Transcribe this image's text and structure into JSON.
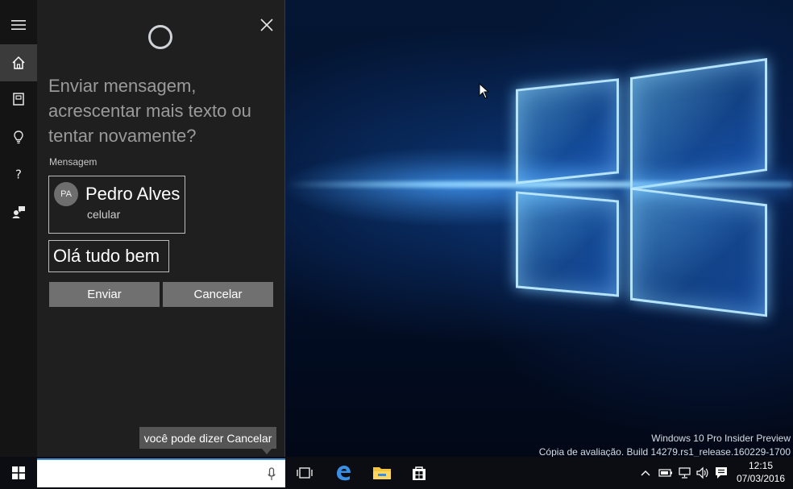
{
  "cortana": {
    "prompt": "Enviar mensagem, acrescentar mais texto ou tentar novamente?",
    "message_label": "Mensagem",
    "contact": {
      "initials": "PA",
      "name": "Pedro Alves",
      "type": "celular"
    },
    "message_text": "Olá tudo bem",
    "send_label": "Enviar",
    "cancel_label": "Cancelar",
    "tip": "você pode dizer Cancelar",
    "rail": [
      "menu-icon",
      "home-icon",
      "notebook-icon",
      "lightbulb-icon",
      "help-icon",
      "feedback-icon"
    ]
  },
  "desktop": {
    "watermark_line1": "Windows 10 Pro Insider Preview",
    "watermark_line2": "Cópia de avaliação. Build 14279.rs1_release.160229-1700"
  },
  "taskbar": {
    "pinned": [
      "task-view-icon",
      "edge-icon",
      "file-explorer-icon",
      "store-icon"
    ],
    "tray": [
      "chevron-up-icon",
      "battery-icon",
      "network-icon",
      "volume-icon",
      "notification-icon"
    ],
    "time": "12:15",
    "date": "07/03/2016"
  },
  "colors": {
    "panel_bg": "#1f1f1f",
    "rail_bg": "#141414",
    "button_bg": "#707070",
    "accent": "#3f90d6"
  }
}
